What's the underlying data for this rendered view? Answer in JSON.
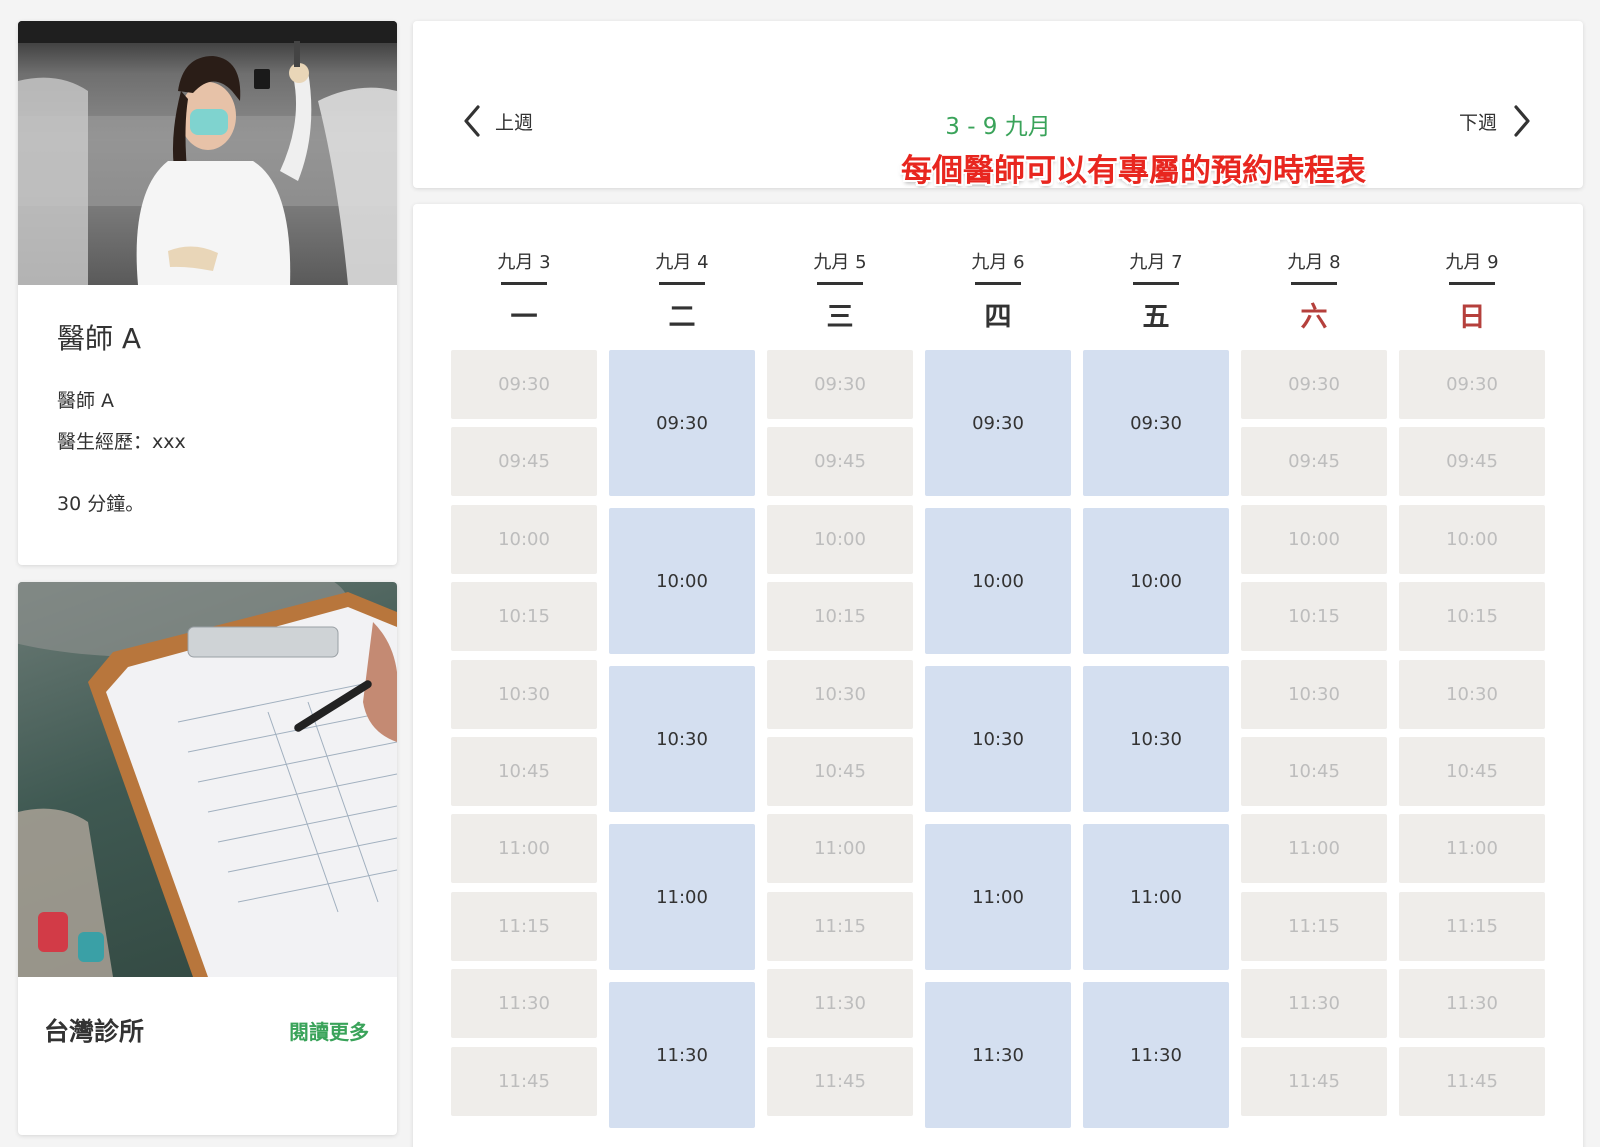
{
  "doctor": {
    "name": "醫師 A",
    "description_line1": "醫師 A",
    "description_line2": "醫生經歷：xxx",
    "description_line3": "30 分鐘。"
  },
  "clinic": {
    "name": "台灣診所",
    "read_more": "閱讀更多"
  },
  "header": {
    "prev_label": "上週",
    "next_label": "下週",
    "week_range": "3 - 9 九月",
    "annotation": "每個醫師可以有專屬的預約時程表"
  },
  "colors": {
    "accent_green": "#3aa35a",
    "annotation_red": "#e8261f",
    "open_slot": "#d4dff0",
    "closed_slot": "#efedea",
    "weekend_red": "#b5403c"
  },
  "schedule": {
    "days": [
      {
        "date": "九月 3",
        "weekday": "一",
        "weekend": false,
        "open": false
      },
      {
        "date": "九月 4",
        "weekday": "二",
        "weekend": false,
        "open": true
      },
      {
        "date": "九月 5",
        "weekday": "三",
        "weekend": false,
        "open": false
      },
      {
        "date": "九月 6",
        "weekday": "四",
        "weekend": false,
        "open": true
      },
      {
        "date": "九月 7",
        "weekday": "五",
        "weekend": false,
        "open": true
      },
      {
        "date": "九月 8",
        "weekday": "六",
        "weekend": true,
        "open": false
      },
      {
        "date": "九月 9",
        "weekday": "日",
        "weekend": true,
        "open": false
      }
    ],
    "closed_times": [
      "09:30",
      "09:45",
      "10:00",
      "10:15",
      "10:30",
      "10:45",
      "11:00",
      "11:15",
      "11:30",
      "11:45"
    ],
    "open_times": [
      "09:30",
      "10:00",
      "10:30",
      "11:00",
      "11:30"
    ]
  }
}
